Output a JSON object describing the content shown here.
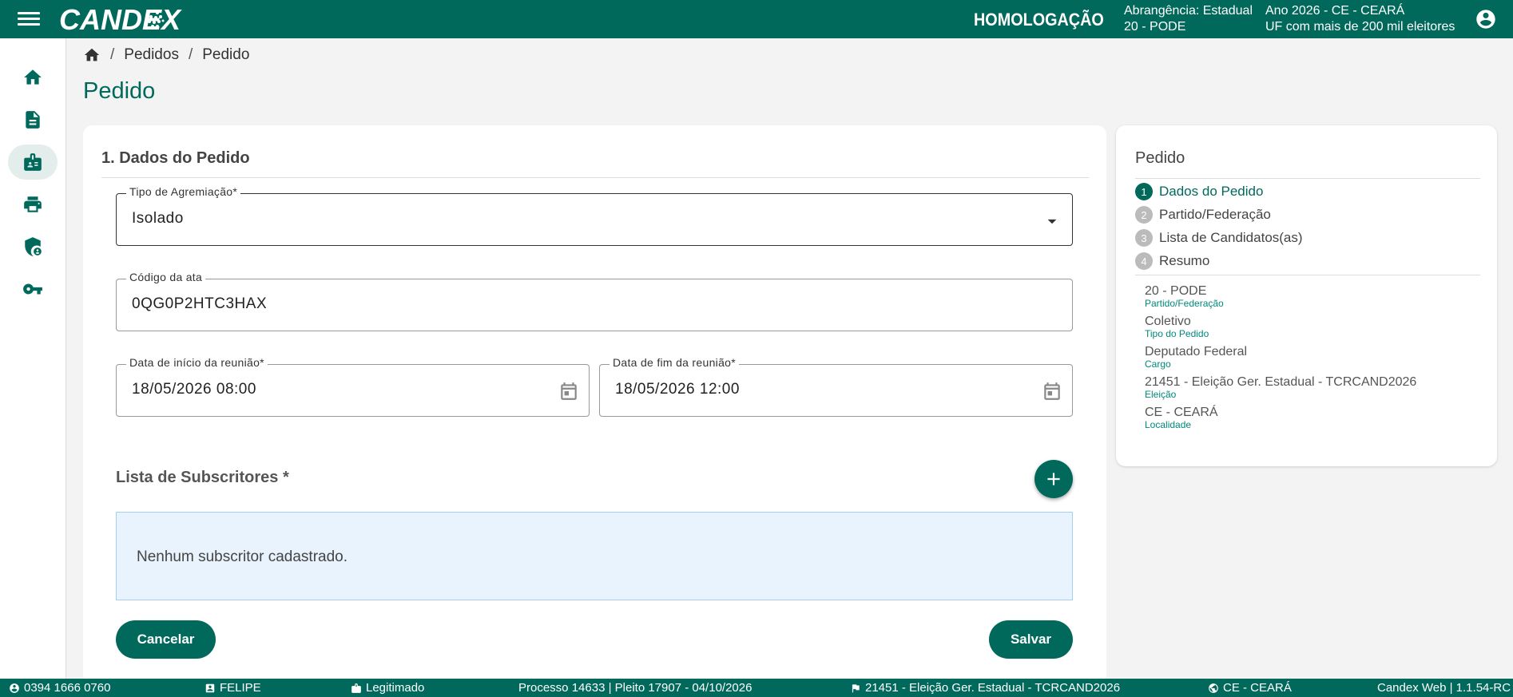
{
  "header": {
    "logo": "CANDEX",
    "environment": "HOMOLOGAÇÃO",
    "scope_line1": "Abrangência: Estadual",
    "scope_line2": "20 - PODE",
    "year_line1": "Ano 2026 - CE - CEARÁ",
    "year_line2": "UF com mais de 200 mil eleitores"
  },
  "sidebar": {
    "items": [
      {
        "icon": "home-icon"
      },
      {
        "icon": "document-icon"
      },
      {
        "icon": "badge-icon",
        "active": true
      },
      {
        "icon": "printer-icon"
      },
      {
        "icon": "shield-user-icon"
      },
      {
        "icon": "key-icon"
      }
    ]
  },
  "breadcrumb": {
    "items": [
      "Pedidos",
      "Pedido"
    ]
  },
  "page": {
    "title": "Pedido"
  },
  "form": {
    "section_title": "1. Dados do Pedido",
    "tipo_label": "Tipo de Agremiação*",
    "tipo_value": "Isolado",
    "codigo_label": "Código da ata",
    "codigo_value": "0QG0P2HTC3HAX",
    "inicio_label": "Data de início da reunião*",
    "inicio_value": "18/05/2026 08:00",
    "fim_label": "Data de fim da reunião*",
    "fim_value": "18/05/2026 12:00",
    "subs_title": "Lista de Subscritores *",
    "subs_empty": "Nenhum subscritor cadastrado.",
    "cancel_label": "Cancelar",
    "save_label": "Salvar"
  },
  "summary": {
    "title": "Pedido",
    "steps": [
      {
        "num": "1",
        "label": "Dados do Pedido",
        "active": true
      },
      {
        "num": "2",
        "label": "Partido/Federação"
      },
      {
        "num": "3",
        "label": "Lista de Candidatos(as)"
      },
      {
        "num": "4",
        "label": "Resumo"
      }
    ],
    "items": [
      {
        "value": "20 - PODE",
        "label": "Partido/Federação"
      },
      {
        "value": "Coletivo",
        "label": "Tipo do Pedido"
      },
      {
        "value": "Deputado Federal",
        "label": "Cargo"
      },
      {
        "value": "21451 - Eleição Ger. Estadual - TCRCAND2026",
        "label": "Eleição"
      },
      {
        "value": "CE - CEARÁ",
        "label": "Localidade"
      }
    ]
  },
  "footer": {
    "phone": "0394 1666 0760",
    "user": "FELIPE",
    "role": "Legitimado",
    "process": "Processo 14633 | Pleito 17907 - 04/10/2026",
    "election": "21451 - Eleição Ger. Estadual - TCRCAND2026",
    "locality": "CE - CEARÁ",
    "version": "Candex Web | 1.1.54-RC"
  },
  "colors": {
    "brand": "#00695c",
    "info_bg": "#e8f3fd"
  }
}
